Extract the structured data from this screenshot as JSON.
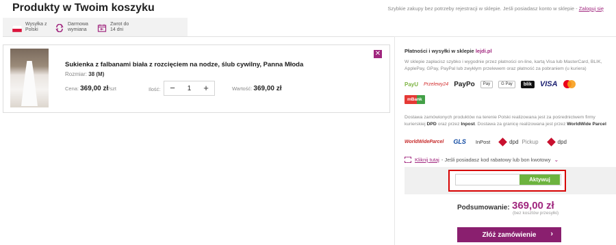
{
  "page": {
    "title": "Produkty w Twoim koszyku",
    "top_note": "Szybkie zakupy bez potrzeby rejestracji w sklepie. Jeśli posiadasz konto w sklepie -",
    "login_link": "Zaloguj się"
  },
  "benefits": [
    {
      "icon": "poland-flag-icon",
      "text": "Wysyłka z\nPolski"
    },
    {
      "icon": "refresh-icon",
      "text": "Darmowa\nwymiana"
    },
    {
      "icon": "calendar-return-icon",
      "text": "Zwrot do\n14 dni"
    }
  ],
  "product": {
    "name": "Sukienka z falbanami biała z rozcięciem na nodze, ślub cywilny, Panna Młoda",
    "size_label": "Rozmiar:",
    "size_value": "38 (M)",
    "price_label": "Cena:",
    "price_value": "369,00 zł",
    "price_unit": "/szt",
    "qty_label": "Ilość:",
    "qty_minus": "−",
    "qty_value": "1",
    "qty_plus": "+",
    "total_label": "Wartość:",
    "total_value": "369,00 zł",
    "remove_symbol": "✕"
  },
  "payments": {
    "title_prefix": "Płatności i wysyłki w sklepie",
    "title_brand": "lejdi.pl",
    "description": "W sklepie zapłacisz szybko i wygodnie przez płatności on-line, kartą Visa lub MasterCard, BLIK, ApplePay, GPay, PayPal lub zwykłym przelewem oraz płatność za pobraniem (u kuriera)",
    "logos": {
      "payu": "PayU",
      "p24": "Przelewy24",
      "paypo": "PayPo",
      "applepay": "Pay",
      "gpay": "G Pay",
      "blik": "blik",
      "visa": "VISA",
      "mbank": "mBank"
    }
  },
  "delivery": {
    "text1": "Dostawa zamówionych produktów na terenie Polski realizowana jest za pośrednictwem firmy kurierskiej",
    "dpd": "DPD",
    "text2": "oraz przez",
    "inpost": "Inpost",
    "text3": ". Dostawa za granicę realizowana jest przez",
    "wwp": "WorldWide Parcel",
    "logos": {
      "wwp": "WorldWideParcel",
      "gls": "GLS",
      "inpost": "InPost",
      "dpd_pickup": "dpd",
      "pickup": "Pickup",
      "dpd": "dpd"
    }
  },
  "promo": {
    "link": "Kliknij tutaj",
    "text": "- Jeśli posiadasz kod rabatowy lub bon kwotowy"
  },
  "coupon": {
    "placeholder": "",
    "button": "Aktywuj"
  },
  "summary": {
    "label": "Podsumowanie:",
    "value": "369,00 zł",
    "note": "(bez kosztów przesyłki)",
    "order_button": "Złóż zamówienie",
    "order_arrow": "›"
  },
  "colors": {
    "brand": "#a0267e",
    "order_button": "#8a1f6f",
    "activate_button": "#6cb33e",
    "highlight_frame": "#d60000"
  }
}
